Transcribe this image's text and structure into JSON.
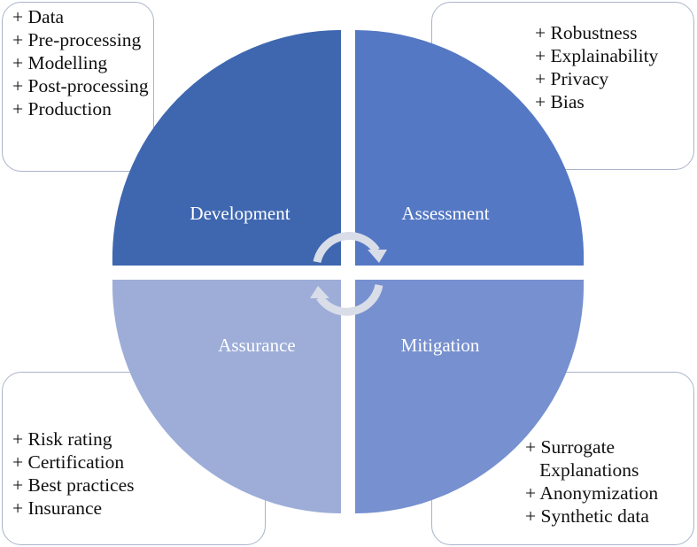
{
  "quadrants": {
    "development": {
      "label": "Development",
      "color": "#3f67b0",
      "items": [
        "+ Data",
        "+ Pre-processing",
        "+ Modelling",
        "+ Post-processing",
        "+ Production"
      ]
    },
    "assessment": {
      "label": "Assessment",
      "color": "#5478c4",
      "items": [
        "+ Robustness",
        "+ Explainability",
        "+ Privacy",
        "+ Bias"
      ]
    },
    "assurance": {
      "label": "Assurance",
      "color": "#9dadd8",
      "items": [
        "+ Risk rating",
        "+ Certification",
        "+ Best practices",
        "+ Insurance"
      ]
    },
    "mitigation": {
      "label": "Mitigation",
      "color": "#7790cf",
      "items": [
        "+ Surrogate",
        "   Explanations",
        "+ Anonymization",
        "+ Synthetic data"
      ]
    }
  },
  "cycle_arrows": [
    "clockwise-arrow-top",
    "clockwise-arrow-bottom"
  ],
  "colors": {
    "box_border": "#a9b3c9",
    "arrow": "#d9dde8",
    "text": "#111111",
    "label_text": "#ffffff"
  }
}
